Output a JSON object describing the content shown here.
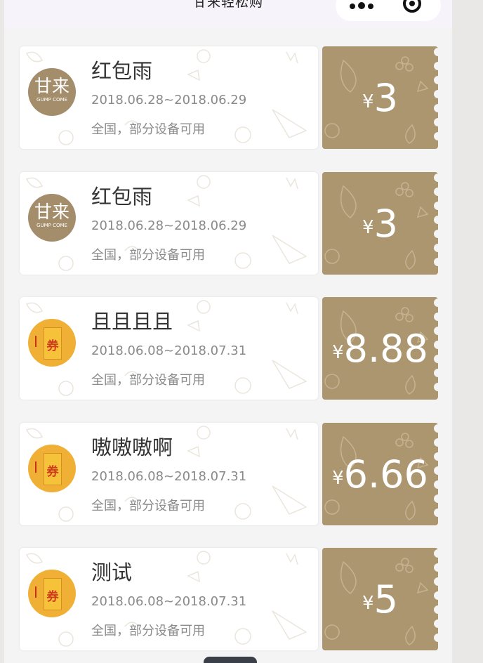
{
  "navbar": {
    "title": "甘来轻松购"
  },
  "coupons": [
    {
      "logo": {
        "type": "gump",
        "cn": "甘来",
        "en": "GUMP COME"
      },
      "title": "红包雨",
      "date": "2018.06.28~2018.06.29",
      "scope": "全国，部分设备可用",
      "currency": "¥",
      "amount": "3"
    },
    {
      "logo": {
        "type": "gump",
        "cn": "甘来",
        "en": "GUMP COME"
      },
      "title": "红包雨",
      "date": "2018.06.28~2018.06.29",
      "scope": "全国，部分设备可用",
      "currency": "¥",
      "amount": "3"
    },
    {
      "logo": {
        "type": "quan",
        "ch": "券"
      },
      "title": "且且且且",
      "date": "2018.06.08~2018.07.31",
      "scope": "全国，部分设备可用",
      "currency": "¥",
      "amount": "8.88"
    },
    {
      "logo": {
        "type": "quan",
        "ch": "券"
      },
      "title": "嗷嗷嗷啊",
      "date": "2018.06.08~2018.07.31",
      "scope": "全国，部分设备可用",
      "currency": "¥",
      "amount": "6.66"
    },
    {
      "logo": {
        "type": "quan",
        "ch": "券"
      },
      "title": "测试",
      "date": "2018.06.08~2018.07.31",
      "scope": "全国，部分设备可用",
      "currency": "¥",
      "amount": "5"
    }
  ],
  "colors": {
    "gold": "#ac9670",
    "logo_brown": "#a38d6b",
    "logo_yellow": "#efb035"
  }
}
